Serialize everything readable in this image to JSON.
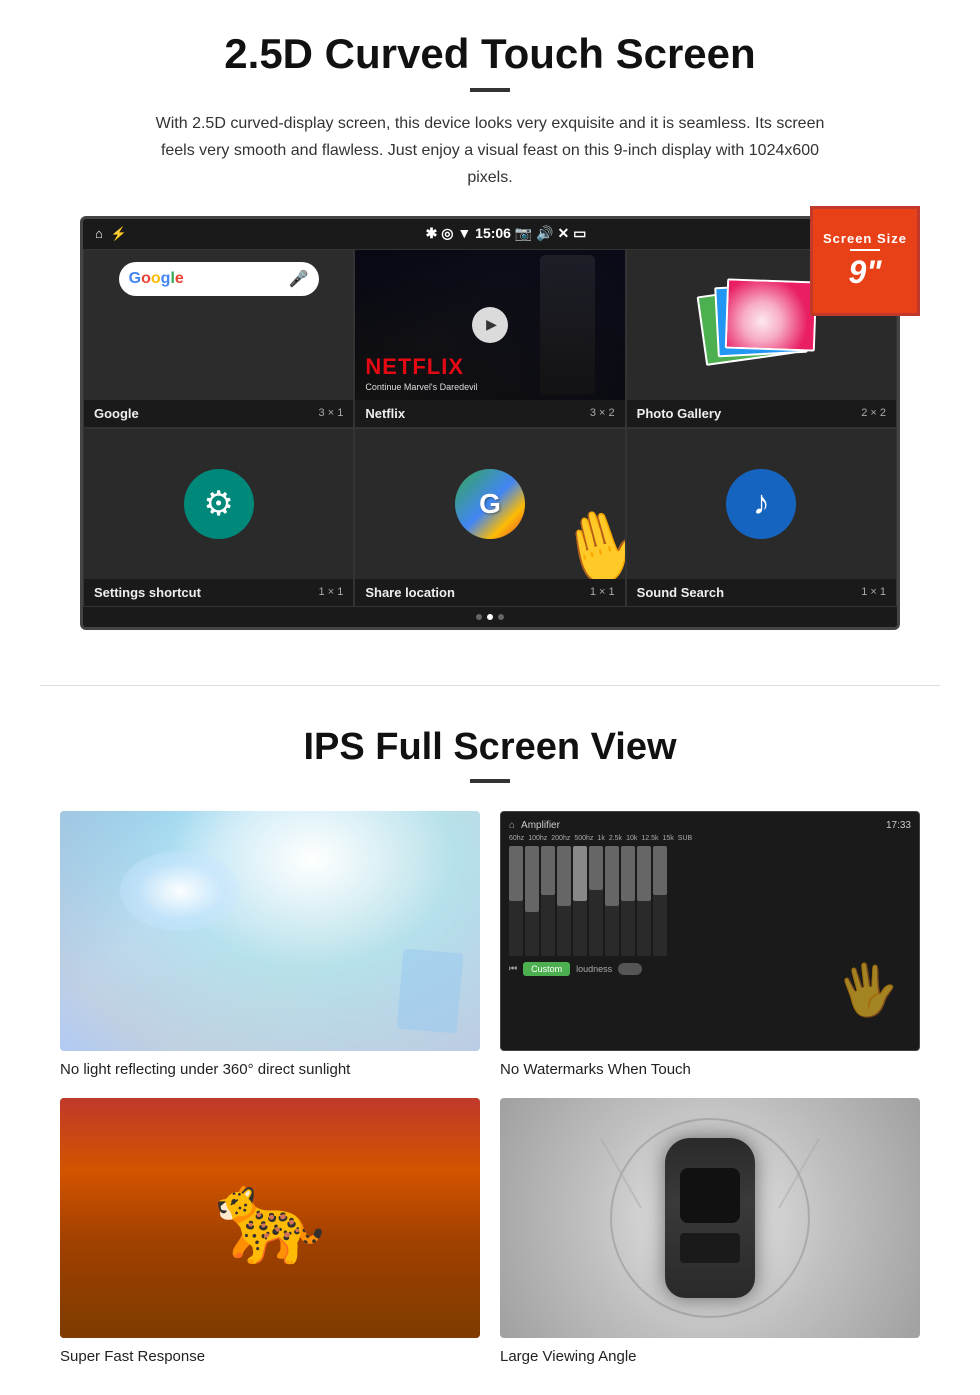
{
  "section1": {
    "title": "2.5D Curved Touch Screen",
    "description": "With 2.5D curved-display screen, this device looks very exquisite and it is seamless. Its screen feels very smooth and flawless. Just enjoy a visual feast on this 9-inch display with 1024x600 pixels.",
    "screen_badge": {
      "label": "Screen Size",
      "size": "9\""
    },
    "status_bar": {
      "time": "15:06"
    },
    "apps": [
      {
        "name": "Google",
        "size": "3 × 1",
        "type": "google"
      },
      {
        "name": "Netflix",
        "size": "3 × 2",
        "type": "netflix",
        "netflix_text": "NETFLIX",
        "netflix_sub": "Continue Marvel's Daredevil"
      },
      {
        "name": "Photo Gallery",
        "size": "2 × 2",
        "type": "gallery"
      },
      {
        "name": "Settings shortcut",
        "size": "1 × 1",
        "type": "settings"
      },
      {
        "name": "Share location",
        "size": "1 × 1",
        "type": "share"
      },
      {
        "name": "Sound Search",
        "size": "1 × 1",
        "type": "sound"
      }
    ]
  },
  "section2": {
    "title": "IPS Full Screen View",
    "features": [
      {
        "label": "No light reflecting under 360° direct sunlight",
        "type": "sunlight"
      },
      {
        "label": "No Watermarks When Touch",
        "type": "amplifier"
      },
      {
        "label": "Super Fast Response",
        "type": "cheetah"
      },
      {
        "label": "Large Viewing Angle",
        "type": "car"
      }
    ]
  }
}
